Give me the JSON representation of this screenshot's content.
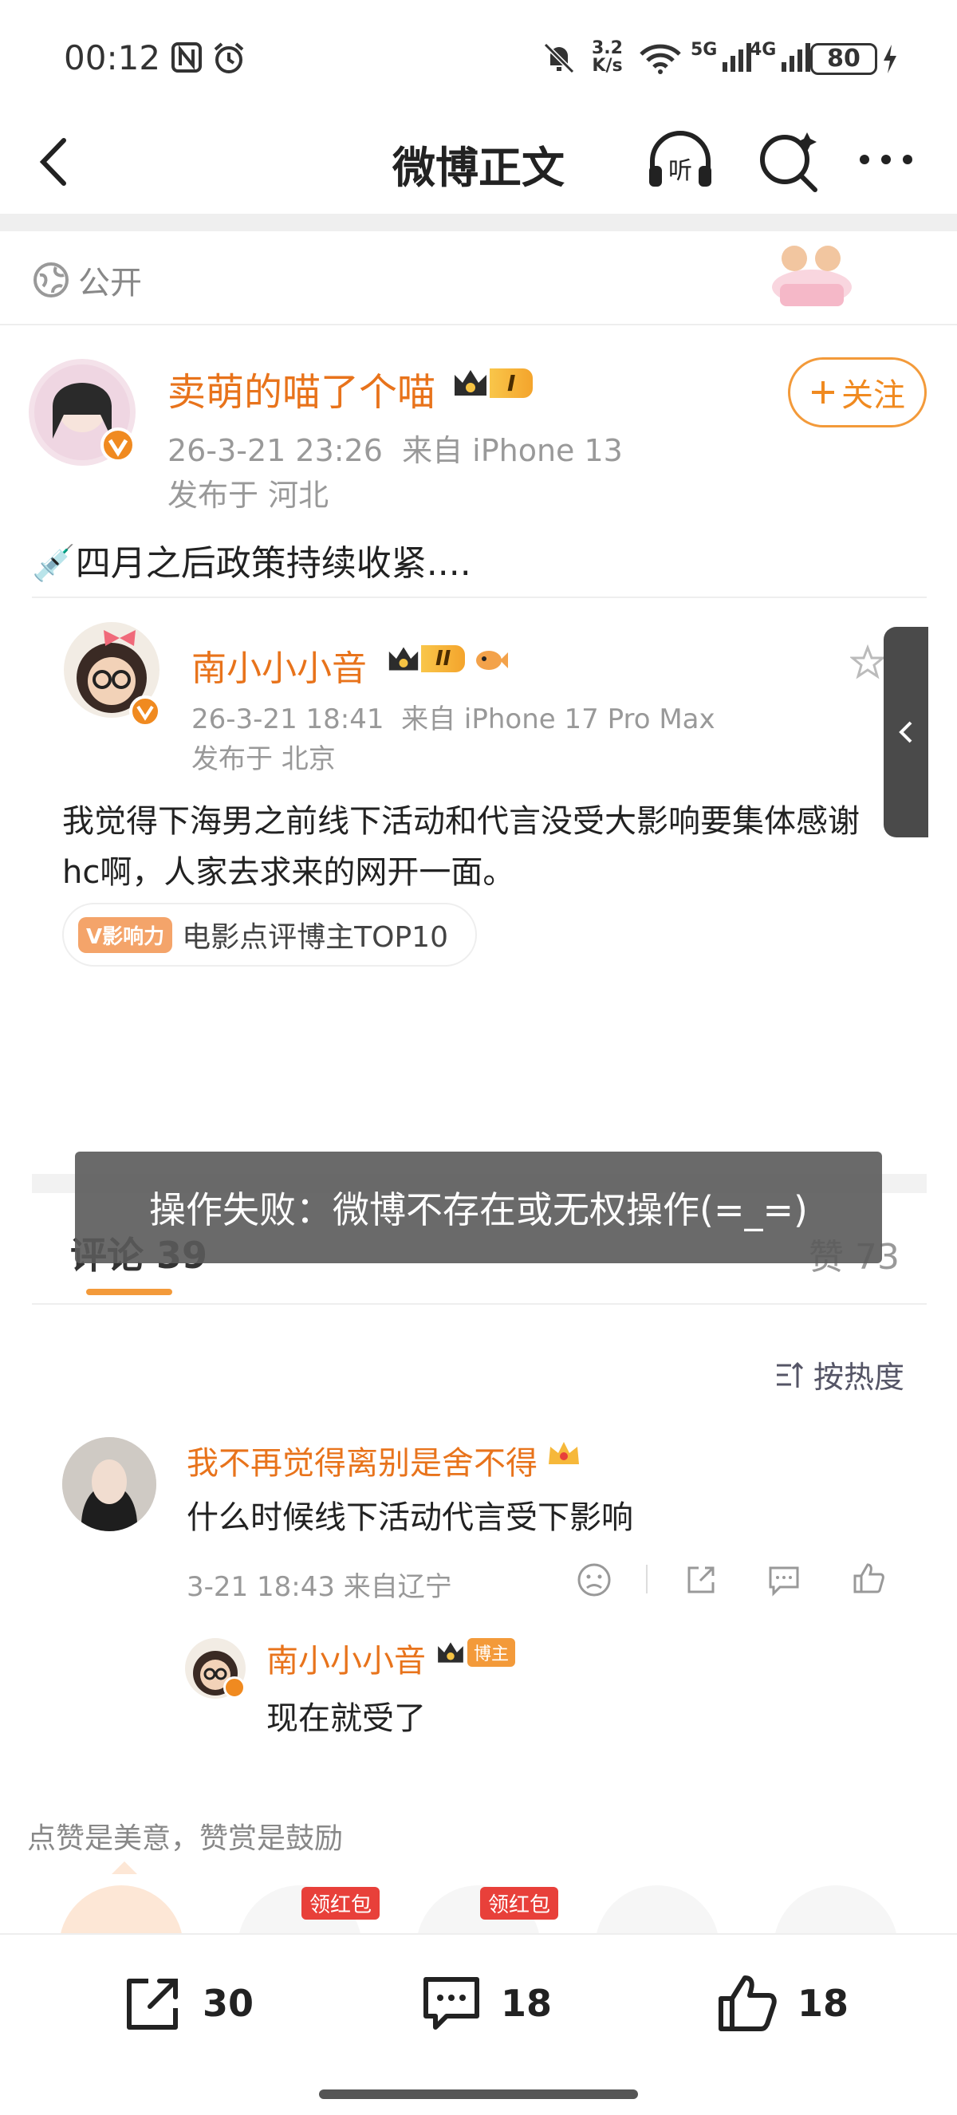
{
  "status_bar": {
    "time": "00:12",
    "net_speed_value": "3.2",
    "net_speed_unit": "K/s",
    "signal1": "5G",
    "signal2": "4G",
    "battery": "80"
  },
  "nav": {
    "title": "微博正文"
  },
  "post": {
    "visibility": "公开",
    "author": "卖萌的喵了个喵",
    "author_level": "I",
    "timestamp": "26-3-21 23:26",
    "source": "来自 iPhone 13",
    "location": "发布于 河北",
    "follow_label": "关注",
    "text": "💉四月之后政策持续收紧....",
    "retweet": {
      "author": "南小小小音",
      "author_level": "II",
      "timestamp": "26-3-21 18:41",
      "source": "来自 iPhone 17 Pro Max",
      "location": "发布于 北京",
      "text": "我觉得下海男之前线下活动和代言没受大影响要集体感谢hc啊，人家去求来的网开一面。",
      "tag_badge": "V影响力",
      "tag_label": "电影点评博主TOP10"
    }
  },
  "toast": {
    "message": "操作失败：微博不存在或无权操作(=_=)"
  },
  "comments_section": {
    "tab_comments": "评论 39",
    "tab_likes": "赞 73",
    "sort_label": "按热度",
    "items": [
      {
        "author": "我不再觉得离别是舍不得",
        "text": "什么时候线下活动代言受下影响",
        "meta": "3-21 18:43 来自辽宁",
        "reply": {
          "author": "南小小小音",
          "badge": "博主",
          "text": "现在就受了"
        }
      }
    ]
  },
  "reward": {
    "caption": "点赞是美意，赞赏是鼓励",
    "red_packet_label": "领红包"
  },
  "bottom_bar": {
    "share_count": "30",
    "comment_count": "18",
    "like_count": "18"
  },
  "colors": {
    "accent": "#e8731b",
    "follow": "#f39a3a",
    "toast_bg": "#5a5a5a"
  }
}
